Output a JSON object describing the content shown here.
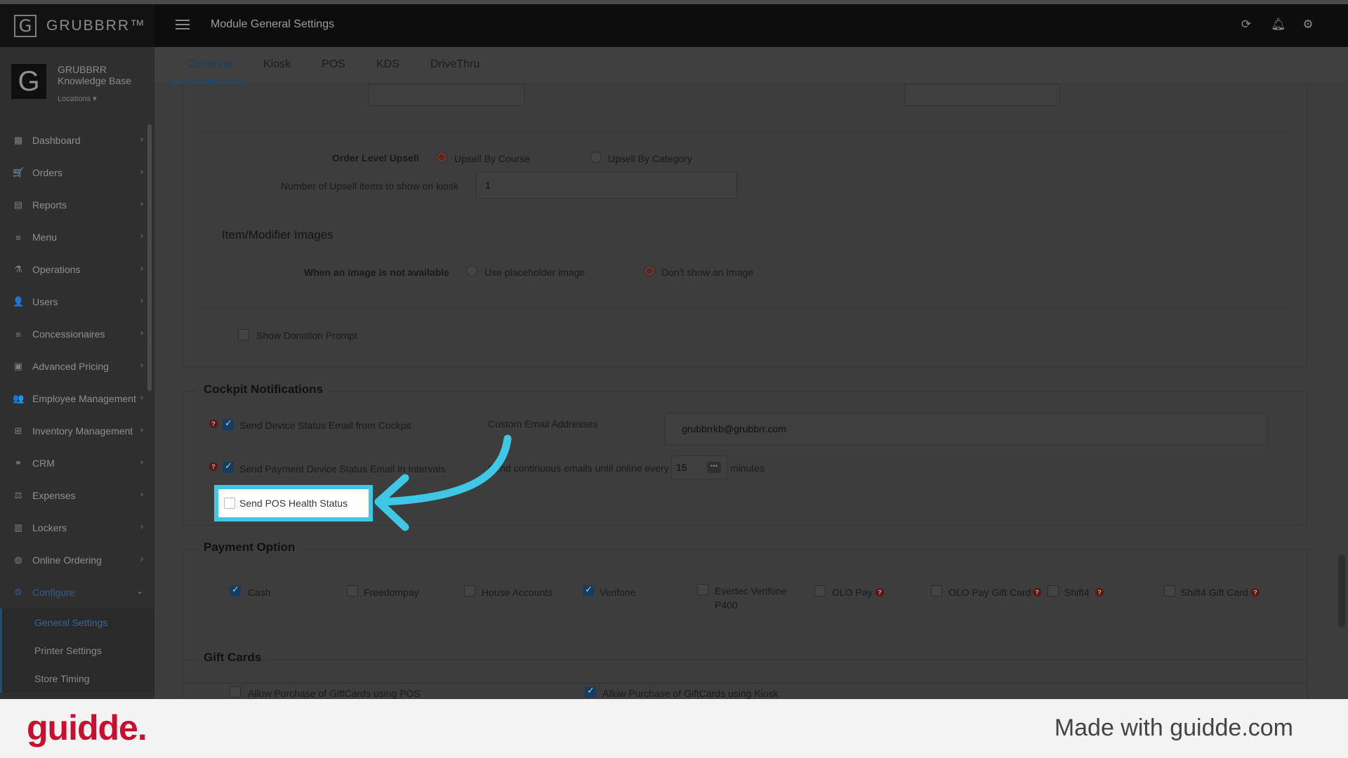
{
  "app": {
    "brand": "GRUBBRR™",
    "brand_logo": "G",
    "page_title": "Module General Settings",
    "icons": [
      "refresh-icon",
      "bell-icon",
      "gear-icon"
    ]
  },
  "sidebar": {
    "org_logo": "G",
    "org_name_1": "GRUBBRR",
    "org_name_2": "Knowledge Base",
    "locations_label": "Locations ▾",
    "items": [
      {
        "label": "Dashboard",
        "icon": "dashboard-icon",
        "glyph": "▦"
      },
      {
        "label": "Orders",
        "icon": "cart-icon",
        "glyph": "🛒"
      },
      {
        "label": "Reports",
        "icon": "report-icon",
        "glyph": "▤"
      },
      {
        "label": "Menu",
        "icon": "menu-icon",
        "glyph": "≡"
      },
      {
        "label": "Operations",
        "icon": "flask-icon",
        "glyph": "⚗"
      },
      {
        "label": "Users",
        "icon": "users-icon",
        "glyph": "👤"
      },
      {
        "label": "Concessionaires",
        "icon": "list-icon",
        "glyph": "≡"
      },
      {
        "label": "Advanced Pricing",
        "icon": "money-icon",
        "glyph": "▣"
      },
      {
        "label": "Employee Management",
        "icon": "group-icon",
        "glyph": "👥"
      },
      {
        "label": "Inventory Management",
        "icon": "sitemap-icon",
        "glyph": "⊞"
      },
      {
        "label": "CRM",
        "icon": "link-icon",
        "glyph": "⚭"
      },
      {
        "label": "Expenses",
        "icon": "balance-icon",
        "glyph": "⚖"
      },
      {
        "label": "Lockers",
        "icon": "locker-icon",
        "glyph": "▥"
      },
      {
        "label": "Online Ordering",
        "icon": "globe-icon",
        "glyph": "◍"
      },
      {
        "label": "Configure",
        "icon": "cog-icon",
        "glyph": "⚙"
      }
    ],
    "sub_items": [
      "General Settings",
      "Printer Settings",
      "Store Timing"
    ]
  },
  "tabs": [
    "Common",
    "Kiosk",
    "POS",
    "KDS",
    "DriveThru"
  ],
  "upsell": {
    "label": "Order Level Upsell",
    "option_course": "Upsell By Course",
    "option_category": "Upsell By Category",
    "count_label": "Number of Upsell items to show on kiosk",
    "count_value": "1"
  },
  "images": {
    "section_title": "Item/Modifier Images",
    "label": "When an image is not available",
    "option_placeholder": "Use placeholder image",
    "option_none": "Don't show an Image"
  },
  "donation": {
    "label": "Show Donation Prompt"
  },
  "cockpit": {
    "title": "Cockpit Notifications",
    "device_status": "Send Device Status Email from Cockpit",
    "custom_emails_label": "Custom Email Addresses",
    "custom_emails_value": "grubbrrkb@grubbrr.com",
    "payment_device": "Send Payment Device Status Email In Intervals",
    "continuous_label": "Send continuous emails until online every",
    "interval_value": "15",
    "minutes": "minutes",
    "pos_health": "Send POS Health Status"
  },
  "payment": {
    "title": "Payment Option",
    "options": [
      {
        "label": "Cash",
        "checked": true
      },
      {
        "label": "Freedompay",
        "checked": false
      },
      {
        "label": "House Accounts",
        "checked": false
      },
      {
        "label": "Verifone",
        "checked": true
      },
      {
        "label": "Evertec Verifone P400",
        "checked": false
      },
      {
        "label": "OLO Pay",
        "checked": false
      },
      {
        "label": "OLO Pay Gift Card",
        "checked": false
      },
      {
        "label": "Shift4",
        "checked": false
      },
      {
        "label": "Shift4 Gift Card",
        "checked": false
      }
    ],
    "evertec_line1": "Evertec Verifone",
    "evertec_line2": "P400"
  },
  "giftcards": {
    "title": "Gift Cards",
    "pos": "Allow Purchase of GiftCards using POS",
    "kiosk": "Allow Purchase of GiftCards using Kiosk"
  },
  "footer": {
    "logo": "guidde.",
    "made_with": "Made with guidde.com"
  },
  "colors": {
    "highlight": "#3fc8e6",
    "brand_red": "#c8102e"
  }
}
